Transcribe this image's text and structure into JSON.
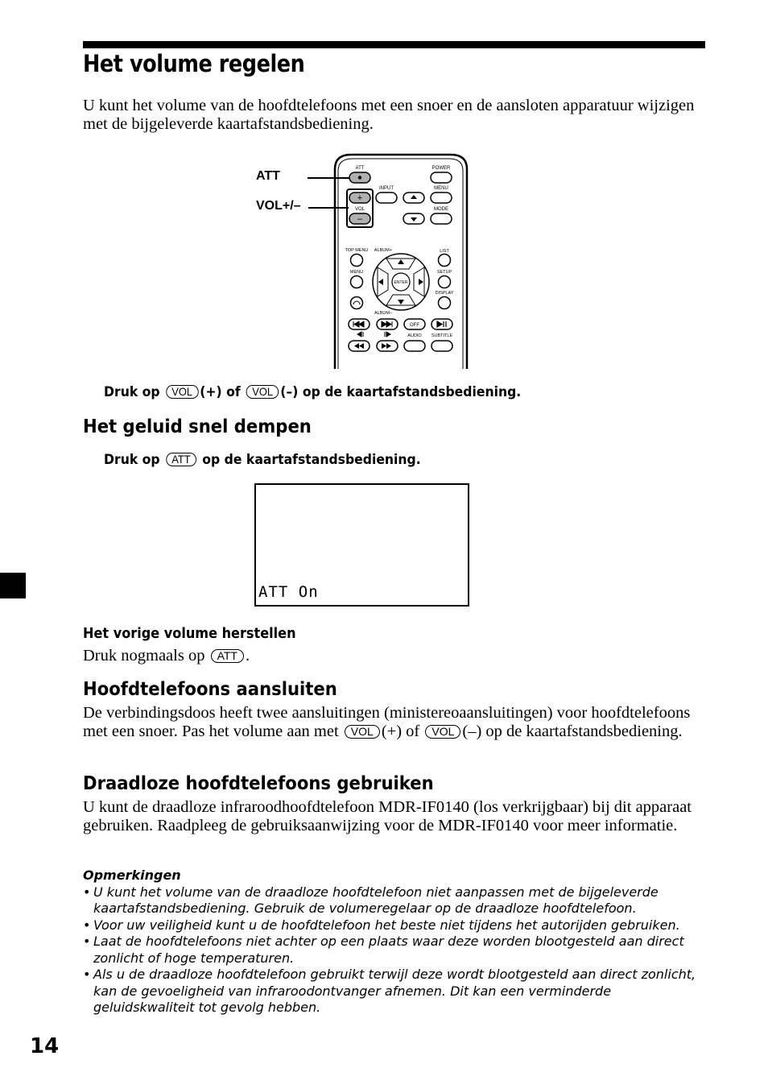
{
  "page": {
    "title": "Het volume regelen",
    "intro": "U kunt het volume van de hoofdtelefoons met een snoer en de aansloten apparatuur wijzigen met de bijgeleverde kaartafstandsbediening.",
    "page_number": "14"
  },
  "figure_remote": {
    "callouts": [
      "ATT",
      "VOL+/–"
    ],
    "button_labels": {
      "att": "ATT",
      "power": "POWER",
      "input": "INPUT",
      "menu_top": "MENU",
      "vol": "VOL",
      "vol_plus": "+",
      "vol_minus": "–",
      "mode": "MODE",
      "top_menu": "TOP MENU",
      "album_plus": "ALBUM+",
      "list": "LIST",
      "menu": "MENU",
      "setup": "SETUP",
      "enter": "ENTER",
      "display": "DISPLAY",
      "album_minus": "ALBUM–",
      "off": "OFF",
      "audio": "AUDIO",
      "subtitle": "SUBTITLE"
    }
  },
  "step_volume": {
    "prefix": "Druk op",
    "key1": "VOL",
    "middle": "(+) of",
    "key2": "VOL",
    "suffix": "(–) op de kaartafstandsbediening."
  },
  "section_mute": {
    "heading": "Het geluid snel dempen",
    "step_prefix": "Druk op",
    "step_key": "ATT",
    "step_suffix": "op de kaartafstandsbediening.",
    "display_text": "ATT On",
    "restore_heading": "Het vorige volume herstellen",
    "restore_prefix": "Druk nogmaals op",
    "restore_key": "ATT",
    "restore_suffix": "."
  },
  "section_connect": {
    "heading": "Hoofdtelefoons aansluiten",
    "text_1": "De verbindingsdoos heeft twee aansluitingen (ministereoaansluitingen) voor hoofdtelefoons met een snoer. Pas het volume aan met",
    "key1": "VOL",
    "text_2": "(+) of",
    "key2": "VOL",
    "text_3": "(–) op de kaartafstandsbediening."
  },
  "section_wireless": {
    "heading": "Draadloze hoofdtelefoons gebruiken",
    "text": "U kunt de draadloze infraroodhoofdtelefoon MDR-IF0140 (los verkrijgbaar) bij dit apparaat gebruiken. Raadpleeg de gebruiksaanwijzing voor de MDR-IF0140 voor meer informatie."
  },
  "notes": {
    "title": "Opmerkingen",
    "bullet": "•",
    "items": [
      "U kunt het volume van de draadloze hoofdtelefoon niet aanpassen met de bijgeleverde kaartafstandsbediening. Gebruik de volumeregelaar op de draadloze hoofdtelefoon.",
      "Voor uw veiligheid kunt u de hoofdtelefoon het beste niet tijdens het autorijden gebruiken.",
      "Laat de hoofdtelefoons niet achter op een plaats waar deze worden blootgesteld aan direct zonlicht of hoge temperaturen.",
      "Als u de draadloze hoofdtelefoon gebruikt terwijl deze wordt blootgesteld aan direct zonlicht, kan de gevoeligheid van infraroodontvanger afnemen. Dit kan een verminderde geluidskwaliteit tot gevolg hebben."
    ]
  }
}
